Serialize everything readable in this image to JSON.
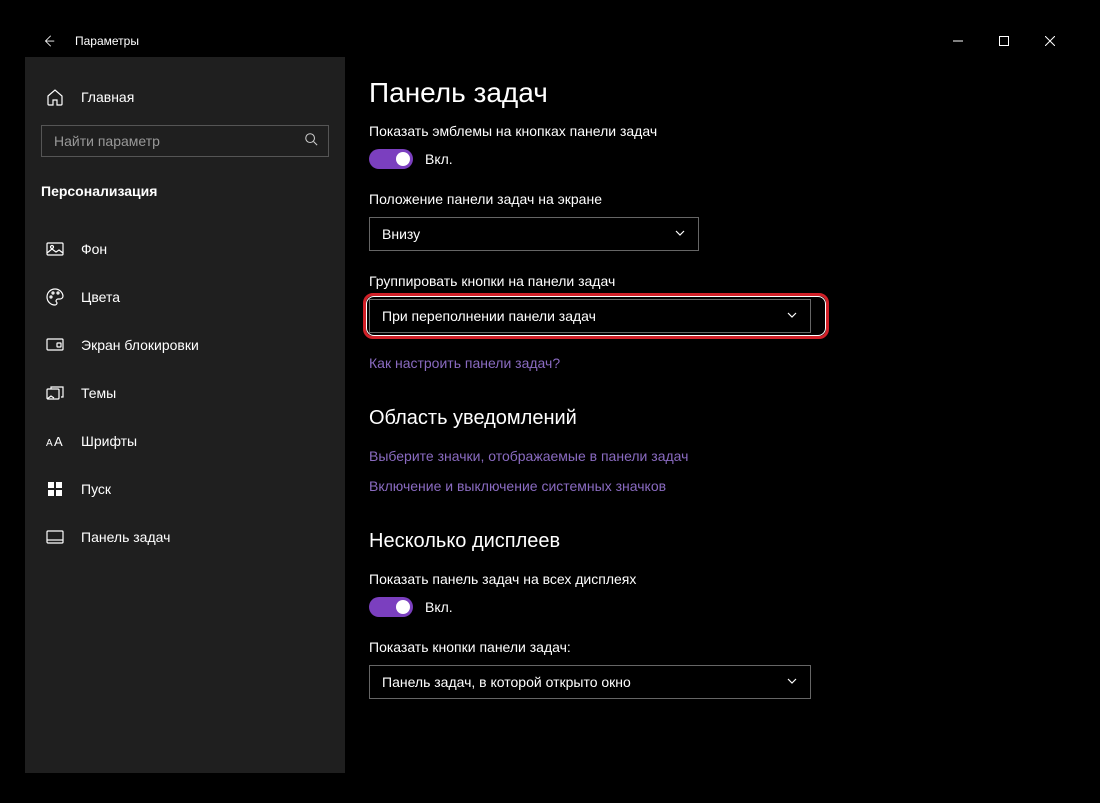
{
  "window": {
    "title": "Параметры"
  },
  "sidebar": {
    "home": "Главная",
    "search_placeholder": "Найти параметр",
    "category": "Персонализация",
    "items": [
      {
        "icon": "image",
        "label": "Фон"
      },
      {
        "icon": "palette",
        "label": "Цвета"
      },
      {
        "icon": "lockscreen",
        "label": "Экран блокировки"
      },
      {
        "icon": "themes",
        "label": "Темы"
      },
      {
        "icon": "fonts",
        "label": "Шрифты"
      },
      {
        "icon": "start",
        "label": "Пуск"
      },
      {
        "icon": "taskbar",
        "label": "Панель задач"
      }
    ]
  },
  "content": {
    "page_title": "Панель задач",
    "setting1_label": "Показать эмблемы на кнопках панели задач",
    "toggle_on": "Вкл.",
    "setting2_label": "Положение панели задач на экране",
    "dropdown1_value": "Внизу",
    "setting3_label": "Группировать кнопки на панели задач",
    "dropdown2_value": "При переполнении панели задач",
    "link1": "Как настроить панели задач?",
    "section2_title": "Область уведомлений",
    "link2": "Выберите значки, отображаемые в панели задач",
    "link3": "Включение и выключение системных значков",
    "section3_title": "Несколько дисплеев",
    "setting4_label": "Показать панель задач на всех дисплеях",
    "setting5_label": "Показать кнопки панели задач:",
    "dropdown3_value": "Панель задач, в которой открыто окно"
  }
}
